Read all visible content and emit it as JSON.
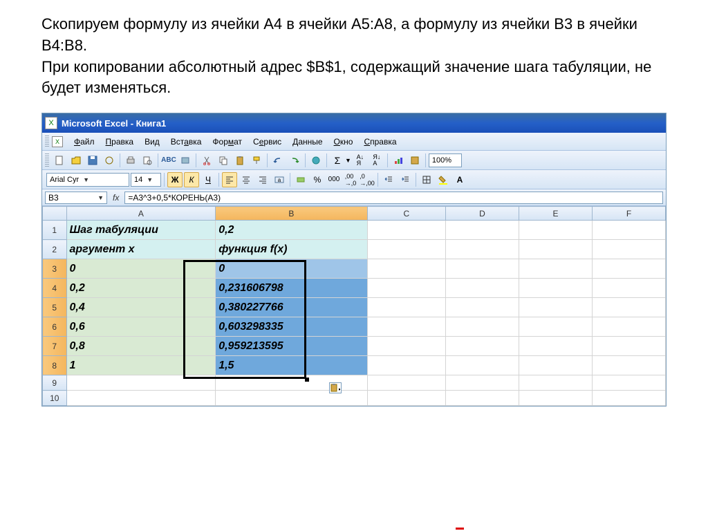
{
  "description": {
    "p1": "Скопируем формулу из ячейки A4 в ячейки A5:A8, а формулу из ячейки B3 в ячейки B4:B8.",
    "p2": "При копировании абсолютный адрес $B$1, содержащий значение шага табуляции, не будет изменяться."
  },
  "titlebar": {
    "title": "Microsoft Excel - Книга1",
    "icon_glyph": "X"
  },
  "menu": {
    "file": "Файл",
    "edit": "Правка",
    "view": "Вид",
    "insert": "Вставка",
    "format": "Формат",
    "service": "Сервис",
    "data": "Данные",
    "window": "Окно",
    "help": "Справка"
  },
  "format_bar": {
    "font": "Arial Cyr",
    "size": "14",
    "bold": "Ж",
    "italic": "К",
    "underline": "Ч",
    "zoom": "100%"
  },
  "formula_bar": {
    "cell_ref": "B3",
    "fx": "fx",
    "formula": "=A3^3+0,5*КОРЕНЬ(A3)"
  },
  "columns": [
    "A",
    "B",
    "C",
    "D",
    "E",
    "F"
  ],
  "rows": {
    "1": {
      "A": "Шаг табуляции",
      "B": "0,2"
    },
    "2": {
      "A": "аргумент x",
      "B": "функция f(x)"
    },
    "3": {
      "A": "0",
      "B": "0"
    },
    "4": {
      "A": "0,2",
      "B": "0,231606798"
    },
    "5": {
      "A": "0,4",
      "B": "0,380227766"
    },
    "6": {
      "A": "0,6",
      "B": "0,603298335"
    },
    "7": {
      "A": "0,8",
      "B": "0,959213595"
    },
    "8": {
      "A": "1",
      "B": "1,5"
    }
  }
}
